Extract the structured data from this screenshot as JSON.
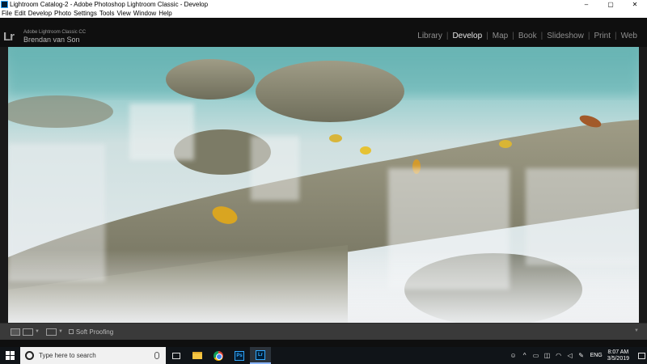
{
  "window": {
    "title": "Lightroom Catalog-2 - Adobe Photoshop Lightroom Classic - Develop",
    "controls": {
      "minimize": "–",
      "maximize": "▢",
      "close": "✕"
    }
  },
  "menu": [
    "File",
    "Edit",
    "Develop",
    "Photo",
    "Settings",
    "Tools",
    "View",
    "Window",
    "Help"
  ],
  "identity": {
    "logo": "Lr",
    "product": "Adobe Lightroom Classic CC",
    "owner": "Brendan van Son"
  },
  "modules": [
    "Library",
    "Develop",
    "Map",
    "Book",
    "Slideshow",
    "Print",
    "Web"
  ],
  "active_module": "Develop",
  "toolbar": {
    "soft_proofing_label": "Soft Proofing",
    "soft_proofing_checked": false
  },
  "taskbar": {
    "search_placeholder": "Type here to search",
    "apps": [
      "task-view",
      "file-explorer",
      "chrome",
      "photoshop",
      "lightroom"
    ],
    "active_app": "lightroom",
    "ps_label": "Ps",
    "lr_label": "Lr",
    "language": "ENG",
    "time": "8:07 AM",
    "date": "3/5/2019"
  },
  "colors": {
    "lightroom_blue": "#31a8ff",
    "module_active": "#e6e6e6",
    "module_inactive": "#8f8f8f"
  }
}
